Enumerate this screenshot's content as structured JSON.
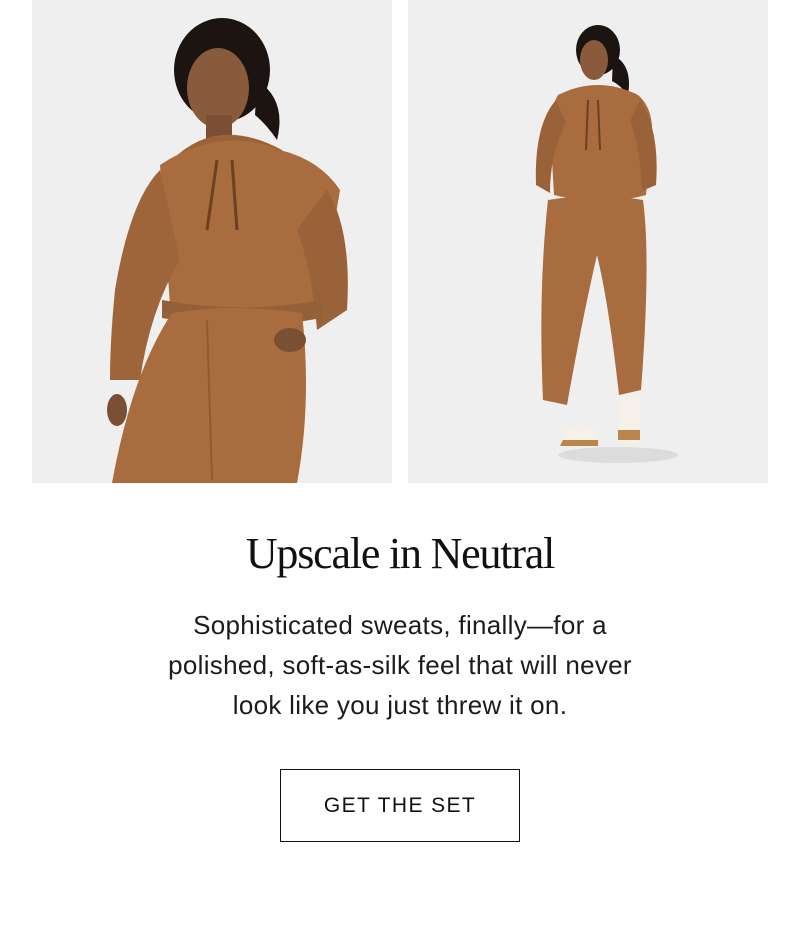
{
  "hero_images": {
    "left": {
      "alt": "model-hoodie-closeup-image"
    },
    "right": {
      "alt": "model-full-outfit-image"
    }
  },
  "headline": "Upscale in Neutral",
  "body_copy": "Sophisticated sweats, finally—for a polished, soft-as-silk feel that will never look like you just threw it on.",
  "cta": {
    "label": "GET THE SET"
  },
  "colors": {
    "fabric": "#a86c3e",
    "fabric_shadow": "#8e5a31",
    "background": "#f0f0f0",
    "text": "#111111"
  }
}
